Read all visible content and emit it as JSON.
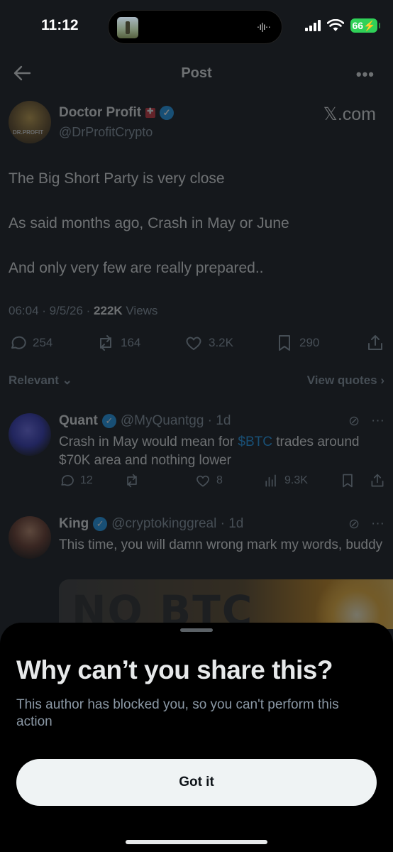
{
  "status_bar": {
    "time": "11:12",
    "battery": "66",
    "island_indicator": "·ı|ı··"
  },
  "header": {
    "title": "Post"
  },
  "post": {
    "author_name": "Doctor Profit",
    "author_handle": "@DrProfitCrypto",
    "avatar_label": "DR.PROFIT",
    "source": "𝕏.com",
    "paragraphs": [
      "The Big Short Party is very close",
      "As said months ago, Crash in May or June",
      "And only very few are really prepared.."
    ],
    "time_date": "06:04 · 9/5/26 · ",
    "views_count": "222K",
    "views_label": " Views",
    "stats": {
      "replies": "254",
      "reposts": "164",
      "likes": "3.2K",
      "bookmarks": "290"
    }
  },
  "sort": {
    "label": "Relevant ⌄",
    "quotes": "View quotes ›"
  },
  "replies": [
    {
      "name": "Quant",
      "handle": "@MyQuantgg · 1d",
      "text_before": "Crash in May would mean for ",
      "cashtag": "$BTC",
      "text_after": " trades around $70K area and nothing lower",
      "stats": {
        "replies": "12",
        "reposts": "",
        "likes": "8",
        "views": "9.3K"
      }
    },
    {
      "name": "King",
      "handle": "@cryptokinggreal · 1d",
      "text": "This time, you will damn wrong mark my words, buddy",
      "media_text": "NO BTC"
    }
  ],
  "sheet": {
    "title": "Why can’t you share this?",
    "body": "This author has blocked you, so you can't perform this action",
    "button": "Got it"
  },
  "colors": {
    "accent": "#1d9bf0",
    "sheet_bg": "#000000",
    "button_bg": "#eff3f4",
    "battery": "#30d158"
  }
}
